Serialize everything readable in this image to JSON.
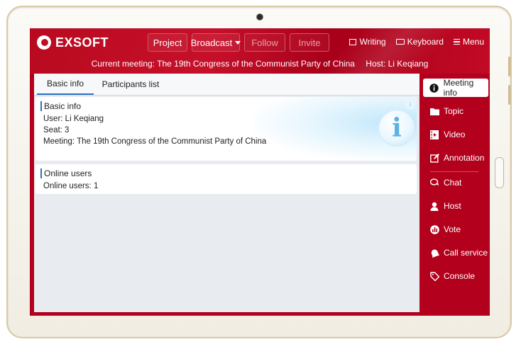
{
  "brand": {
    "name": "EXSOFT"
  },
  "toolbar": {
    "project": "Project",
    "broadcast": "Broadcast",
    "follow": "Follow",
    "invite": "Invite"
  },
  "top_right": {
    "writing": "Writing",
    "keyboard": "Keyboard",
    "menu": "Menu"
  },
  "meeting_bar": {
    "current": "Current meeting: The 19th Congress of the Communist Party of China",
    "host": "Host: Li Keqiang"
  },
  "tabs": [
    {
      "label": "Basic info",
      "active": true
    },
    {
      "label": "Participants list",
      "active": false
    }
  ],
  "basic_info": {
    "title": "Basic info",
    "user": "User: Li Keqiang",
    "seat": "Seat: 3",
    "meeting": "Meeting: The 19th Congress of the Communist Party of China",
    "icon_glyph": "i"
  },
  "online": {
    "title": "Online users",
    "count_text": "Online users: 1"
  },
  "sidebar": {
    "items": [
      {
        "label": "Meeting info",
        "icon": "info-icon",
        "active": true
      },
      {
        "label": "Topic",
        "icon": "folder-icon"
      },
      {
        "label": "Video",
        "icon": "video-icon"
      },
      {
        "label": "Annotation",
        "icon": "edit-icon"
      },
      {
        "label": "Chat",
        "icon": "chat-icon"
      },
      {
        "label": "Host",
        "icon": "user-icon"
      },
      {
        "label": "Vote",
        "icon": "vote-icon"
      },
      {
        "label": "Call service",
        "icon": "bell-icon"
      },
      {
        "label": "Console",
        "icon": "tag-icon"
      }
    ]
  },
  "colors": {
    "primary_red": "#b3001c",
    "accent_blue": "#2a6fc8",
    "content_bg": "#e8ebef"
  }
}
